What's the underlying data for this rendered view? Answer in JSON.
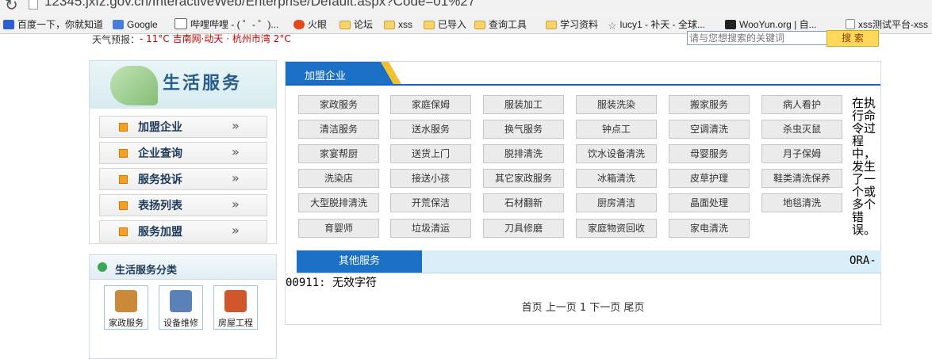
{
  "browser": {
    "url": "12345.jxfz.gov.cn/InteractiveWeb/Enterprise/Default.aspx?Code=01%27",
    "bookmarks": [
      {
        "label": "百度一下，你就知道",
        "icon": "paw-icon"
      },
      {
        "label": "Google",
        "icon": "google-icon"
      },
      {
        "label": "哔哩哔哩 - ( ゜- ゜)...",
        "icon": "tv-icon"
      },
      {
        "label": "火眼",
        "icon": "fire-icon"
      },
      {
        "label": "论坛",
        "icon": "folder-icon"
      },
      {
        "label": "xss",
        "icon": "folder-icon"
      },
      {
        "label": "已导入",
        "icon": "folder-icon"
      },
      {
        "label": "查询工具",
        "icon": "folder-icon"
      },
      {
        "label": "学习资料",
        "icon": "folder-icon"
      },
      {
        "label": "lucy1 - 补天 - 全球...",
        "icon": "star-icon"
      },
      {
        "label": "WooYun.org | 自...",
        "icon": "wooyun-icon"
      },
      {
        "label": "xss测试平台-xss",
        "icon": "doc-icon"
      }
    ]
  },
  "header": {
    "weather_label": "天气预报：",
    "weather_extra": "- 11°C 吉南网·动天 · 杭州市湾 2°C",
    "search_placeholder": "请与您想搜索的关键词",
    "search_button": "搜 索"
  },
  "sidebar": {
    "title": "生活服务",
    "items": [
      {
        "label": "加盟企业"
      },
      {
        "label": "企业查询"
      },
      {
        "label": "服务投诉"
      },
      {
        "label": "表扬列表"
      },
      {
        "label": "服务加盟"
      }
    ],
    "chevron": "»"
  },
  "categories": {
    "title": "生活服务分类",
    "tiles": [
      {
        "label": "家政服务",
        "icon": "housekeeper-icon",
        "color": "#c98a3a"
      },
      {
        "label": "设备维修",
        "icon": "tools-icon",
        "color": "#5a82b8"
      },
      {
        "label": "房屋工程",
        "icon": "house-icon",
        "color": "#d0572c"
      }
    ]
  },
  "main": {
    "tab_label": "加盟企业",
    "services": [
      [
        "家政服务",
        "家庭保姆",
        "服装加工",
        "服装洗染",
        "搬家服务",
        "病人看护"
      ],
      [
        "清洁服务",
        "送水服务",
        "换气服务",
        "钟点工",
        "空调清洗",
        "杀虫灭鼠"
      ],
      [
        "家宴帮厨",
        "送货上门",
        "脱排清洗",
        "饮水设备清洗",
        "母婴服务",
        "月子保姆"
      ],
      [
        "洗染店",
        "接送小孩",
        "其它家政服务",
        "冰箱清洗",
        "皮草护理",
        "鞋类清洗保养"
      ],
      [
        "大型脱排清洗",
        "开荒保洁",
        "石材翻新",
        "厨房清洁",
        "晶面处理",
        "地毯清洗"
      ],
      [
        "育婴师",
        "垃圾清运",
        "刀具修磨",
        "家庭物资回收",
        "家电清洗"
      ]
    ],
    "other_tab": "其他服务",
    "pager": "首页 上一页 1 下一页 尾页"
  },
  "error": {
    "text": "在执行命令过程中，发生了一个或多个错误。",
    "code": "ORA-",
    "line2": "00911: 无效字符"
  },
  "colors": {
    "tab_blue": "#1b6fc4",
    "tab_accent": "#f2c12e",
    "sidebar_title": "#2a5d8f"
  }
}
